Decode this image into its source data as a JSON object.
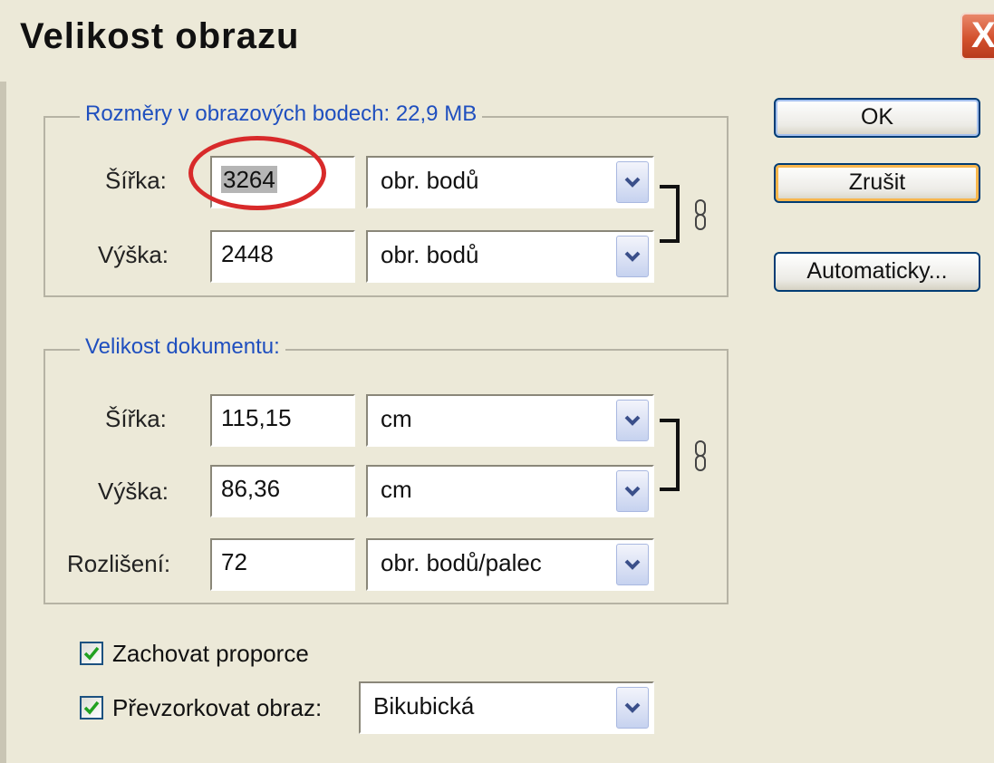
{
  "window": {
    "title": "Velikost obrazu",
    "close_label": "X"
  },
  "pixel_dimensions": {
    "legend": "Rozměry v obrazových bodech:  22,9 MB",
    "width_label": "Šířka:",
    "width_value": "3264",
    "width_unit": "obr. bodů",
    "height_label": "Výška:",
    "height_value": "2448",
    "height_unit": "obr. bodů"
  },
  "document_size": {
    "legend": "Velikost dokumentu:",
    "width_label": "Šířka:",
    "width_value": "115,15",
    "width_unit": "cm",
    "height_label": "Výška:",
    "height_value": "86,36",
    "height_unit": "cm",
    "resolution_label": "Rozlišení:",
    "resolution_value": "72",
    "resolution_unit": "obr. bodů/palec"
  },
  "options": {
    "constrain_label": "Zachovat proporce",
    "constrain_checked": true,
    "resample_label": "Převzorkovat obraz:",
    "resample_checked": true,
    "resample_method": "Bikubická"
  },
  "buttons": {
    "ok": "OK",
    "cancel": "Zrušit",
    "auto": "Automaticky..."
  },
  "colors": {
    "accent_legend": "#1f4fbf",
    "highlight": "#d82a2a"
  }
}
